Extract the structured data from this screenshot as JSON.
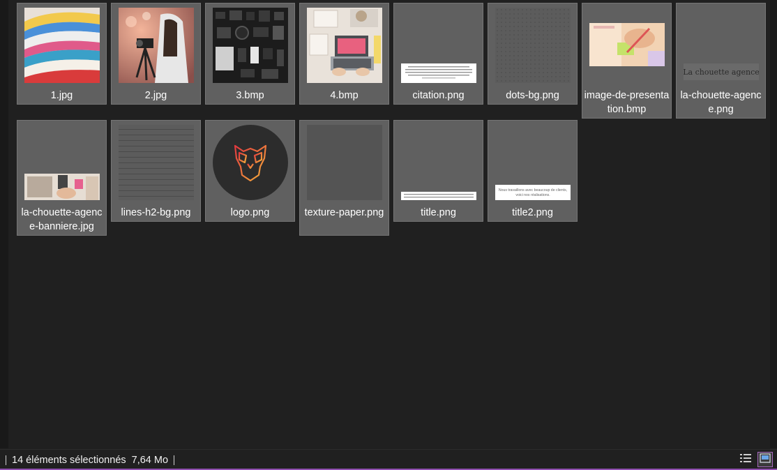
{
  "files": [
    {
      "name": "1.jpg"
    },
    {
      "name": "2.jpg"
    },
    {
      "name": "3.bmp"
    },
    {
      "name": "4.bmp"
    },
    {
      "name": "citation.png"
    },
    {
      "name": "dots-bg.png"
    },
    {
      "name": "image-de-presentation.bmp"
    },
    {
      "name": "la-chouette-agence.png"
    },
    {
      "name": "la-chouette-agence-banniere.jpg"
    },
    {
      "name": "lines-h2-bg.png"
    },
    {
      "name": "logo.png"
    },
    {
      "name": "texture-paper.png"
    },
    {
      "name": "title.png"
    },
    {
      "name": "title2.png"
    }
  ],
  "thumb_text": {
    "chouette_logo": "La chouette agence",
    "title2_line1": "Nous travaillons avec beaucoup de clients,",
    "title2_line2": "voici nos réalisations."
  },
  "status": {
    "selection": "14 éléments sélectionnés",
    "size": "7,64 Mo"
  },
  "colors": {
    "background": "#202020",
    "tile": "#606060",
    "accent": "#8f4fb0"
  },
  "icons": {
    "details_view": "details-view-icon",
    "large_icons_view": "large-icons-view-icon"
  }
}
